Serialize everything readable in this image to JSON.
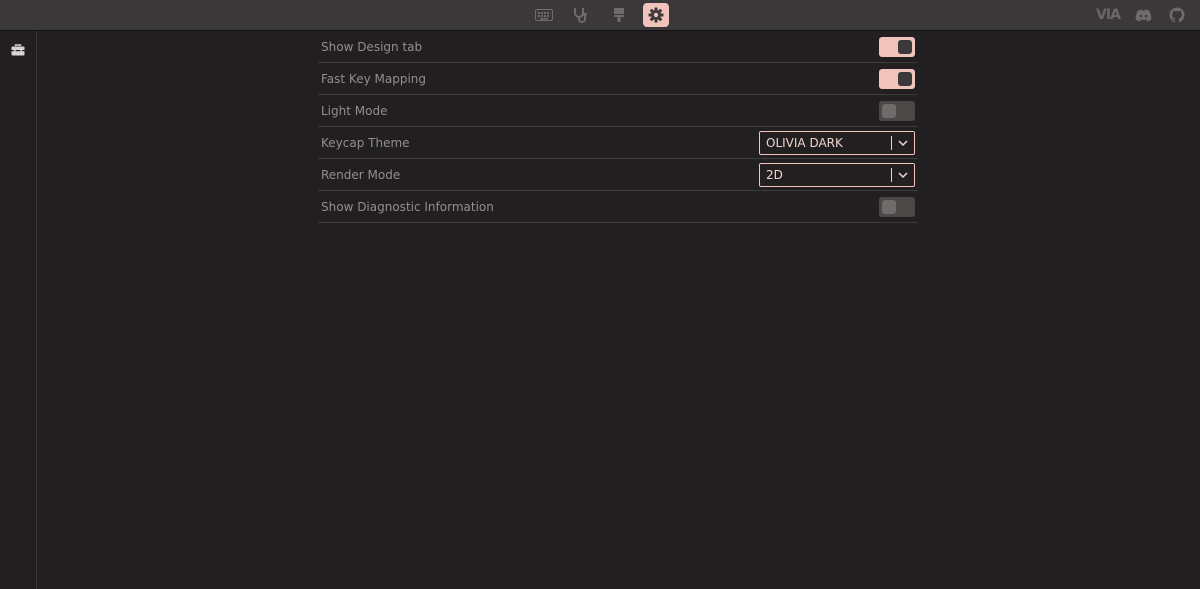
{
  "topbar": {
    "nav_icons": [
      "keyboard-icon",
      "stethoscope-icon",
      "design-icon",
      "settings-icon"
    ],
    "active_tab": "settings-icon",
    "brand": "VIA",
    "right_icons": [
      "discord-icon",
      "github-icon"
    ]
  },
  "sidebar": {
    "icons": [
      "toolbox-icon"
    ]
  },
  "settings": {
    "rows": [
      {
        "label": "Show Design tab",
        "type": "toggle",
        "on": true
      },
      {
        "label": "Fast Key Mapping",
        "type": "toggle",
        "on": true
      },
      {
        "label": "Light Mode",
        "type": "toggle",
        "on": false
      },
      {
        "label": "Keycap Theme",
        "type": "select",
        "value": "OLIVIA DARK"
      },
      {
        "label": "Render Mode",
        "type": "select",
        "value": "2D"
      },
      {
        "label": "Show Diagnostic Information",
        "type": "toggle",
        "on": false
      }
    ]
  },
  "colors": {
    "accent": "#f1c3bd",
    "background": "#211f20",
    "topbar": "#3a3838"
  }
}
